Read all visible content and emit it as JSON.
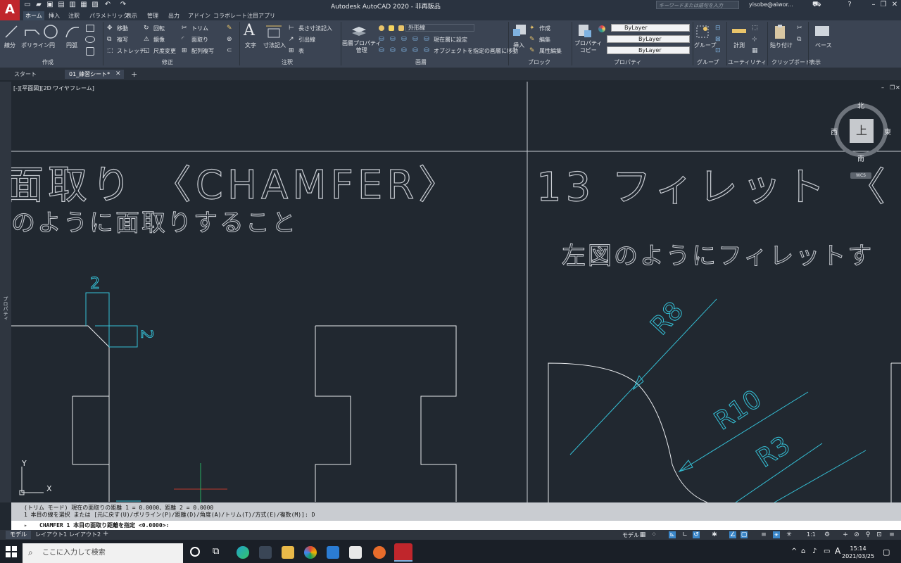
{
  "app": {
    "logo_letter": "A",
    "title": "Autodesk AutoCAD 2020 - 非再販品",
    "search_placeholder": "キーワードまたは語句を入力",
    "user": "yisobe@aiwor..."
  },
  "ribbon_tabs": [
    "ホーム",
    "挿入",
    "注釈",
    "パラメトリック",
    "表示",
    "管理",
    "出力",
    "アドイン",
    "コラボレート",
    "注目アプリ"
  ],
  "ribbon": {
    "draw": {
      "line": "線分",
      "polyline": "ポリライン",
      "circle": "円",
      "arc": "円弧",
      "label": "作成"
    },
    "modify": {
      "move": "移動",
      "rotate": "回転",
      "trim": "トリム",
      "copy": "複写",
      "mirror": "鏡像",
      "fillet": "面取り",
      "stretch": "ストレッチ",
      "scale": "尺度変更",
      "array": "配列複写",
      "label": "修正"
    },
    "annotation": {
      "text": "文字",
      "dimension": "寸法記入",
      "linear": "長さ寸法記入",
      "leader": "引出線",
      "table": "表",
      "label": "注釈"
    },
    "layers": {
      "properties": "画層プロパティ\n管理",
      "current_layer": "外形線",
      "set_current": "現在層に設定",
      "match": "オブジェクトを指定の画層に移動",
      "label": "画層"
    },
    "block": {
      "insert": "挿入",
      "create": "作成",
      "edit": "編集",
      "attr": "属性編集",
      "label": "ブロック"
    },
    "properties": {
      "match": "プロパティ\nコピー",
      "color": "ByLayer",
      "linetype": "ByLayer",
      "lineweight": "ByLayer",
      "label": "プロパティ"
    },
    "groups": {
      "group": "グループ",
      "label": "グループ"
    },
    "utilities": {
      "measure": "計測",
      "label": "ユーティリティ"
    },
    "clipboard": {
      "paste": "貼り付け",
      "label": "クリップボード"
    },
    "view": {
      "base": "ベース",
      "label": "表示"
    }
  },
  "doc_tabs": [
    "スタート",
    "01_練習シート*"
  ],
  "viewport_label": "[-][平面図][2D ワイヤフレーム]",
  "left_palette_label": "プロパティ",
  "viewcube": {
    "north": "北",
    "south": "南",
    "east": "東",
    "west": "西",
    "top": "上",
    "wcs": "WCS"
  },
  "drawing": {
    "left_title": "面取り 〈CHAMFER〉",
    "left_sub": "のように面取りすること",
    "right_title": "13 フィレット 〈",
    "right_sub": "左図のようにフィレットす",
    "dim_top": "2",
    "dim_side": "2",
    "r8": "R8",
    "r10": "R10",
    "r3": "R3",
    "ucs_x": "X",
    "ucs_y": "Y"
  },
  "command": {
    "line1": "(トリム モード) 現在の面取りの距離 1 = 0.0000、距離 2 = 0.0000",
    "line2": "1 本目の線を選択 または [元に戻す(U)/ポリライン(P)/距離(D)/角度(A)/トリム(T)/方式(E)/複数(M)]: D",
    "prompt": "CHAMFER 1 本目の面取り距離を指定 <0.0000>:"
  },
  "layout_tabs": [
    "モデル",
    "レイアウト1",
    "レイアウト2"
  ],
  "status": {
    "model": "モデル",
    "scale": "1:1"
  },
  "taskbar": {
    "search": "ここに入力して検索",
    "time": "15:14",
    "date": "2021/03/25"
  }
}
